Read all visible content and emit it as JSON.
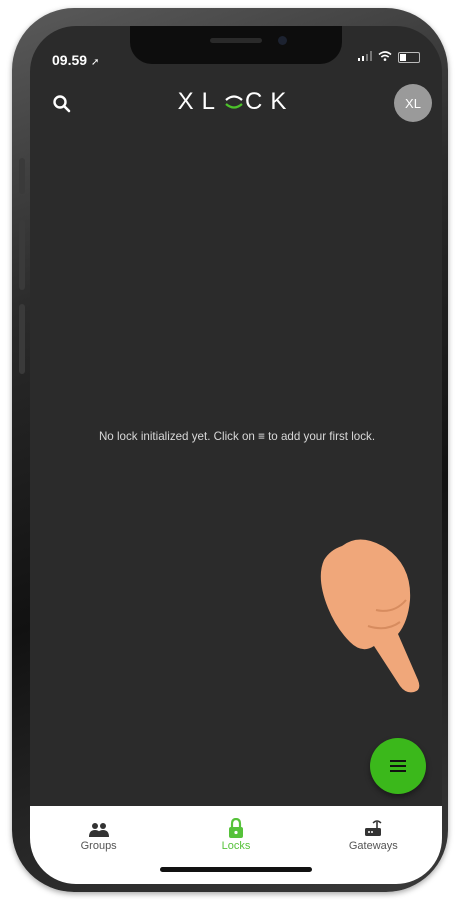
{
  "status_bar": {
    "time": "09.59",
    "location_arrow": "➚"
  },
  "header": {
    "brand_prefix": "XL",
    "brand_suffix": "CK",
    "avatar_initials": "XL"
  },
  "main": {
    "empty_text_before": "No lock initialized yet. Click on ",
    "empty_text_icon": "≡",
    "empty_text_after": " to add your first lock."
  },
  "tabs": [
    {
      "label": "Groups",
      "icon": "groups-icon"
    },
    {
      "label": "Locks",
      "icon": "lock-icon"
    },
    {
      "label": "Gateways",
      "icon": "gateway-icon"
    }
  ],
  "colors": {
    "accent": "#3bb81b",
    "screen_background": "#2b2b2b",
    "hand": "#f0a77a"
  }
}
